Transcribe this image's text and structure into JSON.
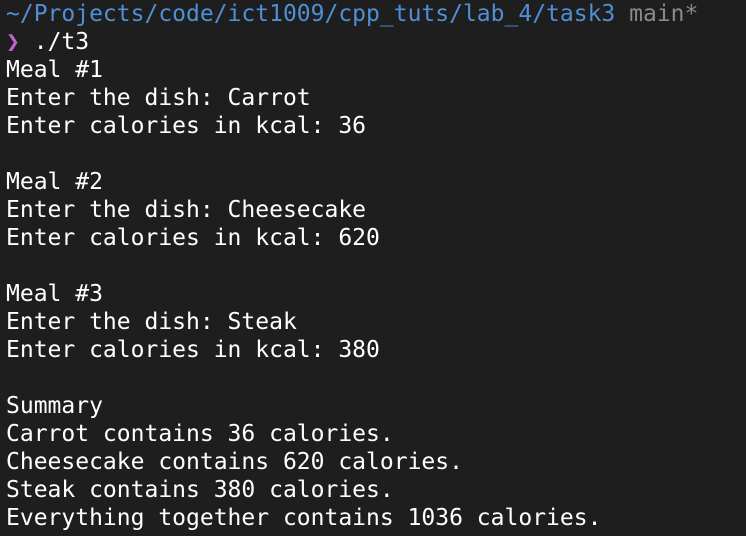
{
  "prompt": {
    "path": "~/Projects/code/ict1009/cpp_tuts/lab_4/task3",
    "branch": "main*",
    "chevron": "❯",
    "command": "./t3"
  },
  "meals": [
    {
      "header": "Meal #1",
      "dish_line": "Enter the dish: Carrot",
      "cal_line": "Enter calories in kcal: 36"
    },
    {
      "header": "Meal #2",
      "dish_line": "Enter the dish: Cheesecake",
      "cal_line": "Enter calories in kcal: 620"
    },
    {
      "header": "Meal #3",
      "dish_line": "Enter the dish: Steak",
      "cal_line": "Enter calories in kcal: 380"
    }
  ],
  "summary": {
    "header": "Summary",
    "lines": [
      "Carrot contains 36 calories.",
      "Cheesecake contains 620 calories.",
      "Steak contains 380 calories.",
      "Everything together contains 1036 calories."
    ]
  },
  "colors": {
    "background": "#1e1e1e",
    "path": "#4f8fd6",
    "branch": "#8a8a8a",
    "chevron": "#c462d2",
    "text": "#ffffff"
  }
}
